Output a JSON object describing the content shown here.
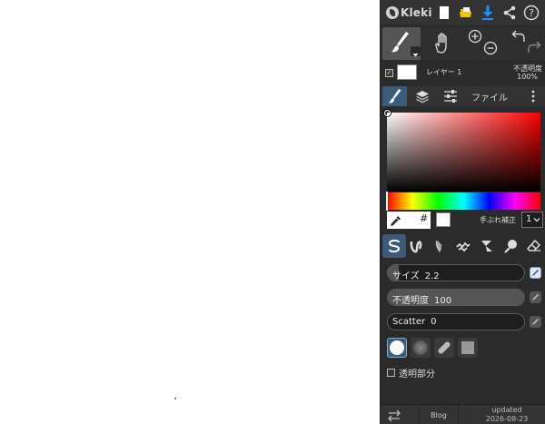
{
  "app": {
    "name": "Kleki"
  },
  "layer": {
    "name": "レイヤー 1",
    "opacity_label": "不透明度",
    "opacity_value": "100%",
    "visible": true
  },
  "tabs": {
    "file_label": "ファイル"
  },
  "color": {
    "hash_label": "#",
    "current": "#ffffff",
    "stabilizer_label": "手ぶれ補正",
    "stabilizer_value": "1"
  },
  "sliders": {
    "size": {
      "label": "サイズ",
      "value": "2.2",
      "fill": 0.08
    },
    "opacity": {
      "label": "不透明度",
      "value": "100",
      "fill": 1.0
    },
    "scatter": {
      "label": "Scatter",
      "value": "0",
      "fill": 0.0
    }
  },
  "lock_alpha": {
    "label": "透明部分",
    "checked": false
  },
  "footer": {
    "blog_label": "Blog",
    "updated_label": "updated",
    "updated_date": "2026-08-23"
  },
  "colors": {
    "accent": "#3c5b78",
    "panel_bg": "#2b2b2b",
    "download_blue": "#1e90ff"
  },
  "icons": [
    "new-image-icon",
    "open-file-icon",
    "download-icon",
    "share-icon",
    "help-icon",
    "brush-icon",
    "hand-icon",
    "zoom-in-icon",
    "zoom-out-icon",
    "undo-icon",
    "redo-icon",
    "layers-icon",
    "adjust-icon",
    "more-icon",
    "eyedropper-icon",
    "pen-brush-icon",
    "blend-brush-icon",
    "sketchy-brush-icon",
    "pixel-brush-icon",
    "chemy-brush-icon",
    "smudge-brush-icon",
    "eraser-icon",
    "pressure-icon",
    "swap-icon"
  ]
}
